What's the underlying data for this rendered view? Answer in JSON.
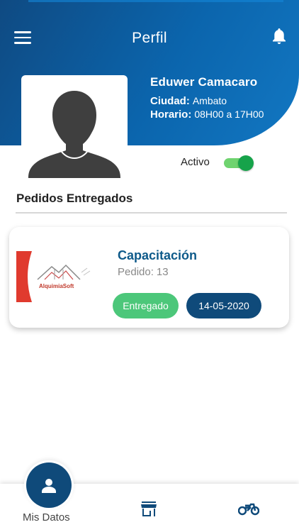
{
  "header": {
    "title": "Perfil",
    "menu_icon": "hamburger-menu-icon",
    "notification_icon": "bell-icon"
  },
  "profile": {
    "name": "Eduwer Camacaro",
    "city_label": "Ciudad:",
    "city_value": "Ambato",
    "hours_label": "Horario:",
    "hours_value": "08H00 a 17H00",
    "status_label": "Activo",
    "status_active": true
  },
  "orders_section": {
    "title": "Pedidos Entregados"
  },
  "orders": [
    {
      "title": "Capacitación",
      "order_label": "Pedido:",
      "order_number": "13",
      "status": "Entregado",
      "date": "14-05-2020",
      "logo_text": "AlquimiaSoft"
    }
  ],
  "bottom_nav": {
    "active_label": "Mis Datos",
    "items": [
      {
        "icon": "person-icon",
        "label": "Mis Datos"
      },
      {
        "icon": "store-icon"
      },
      {
        "icon": "motorcycle-icon"
      }
    ]
  },
  "colors": {
    "primary": "#0f4a7a",
    "header_gradient_end": "#1277c2",
    "status_green": "#4cc77a",
    "toggle_green": "#16a34a",
    "title_blue": "#0e5a8a"
  }
}
